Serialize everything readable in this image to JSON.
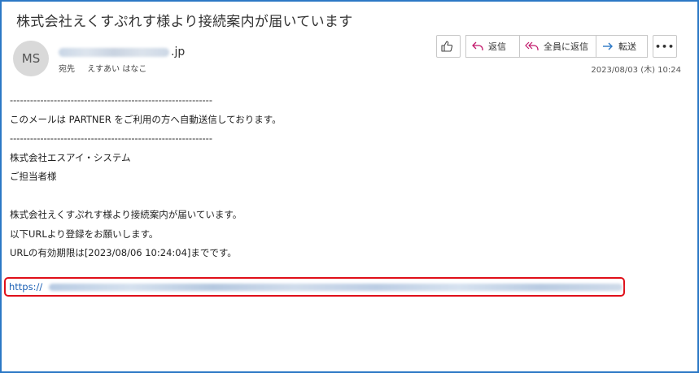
{
  "email": {
    "subject": "株式会社えくすぷれす様より接続案内が届いています",
    "avatar_initials": "MS",
    "sender_domain": ".jp",
    "to_label": "宛先",
    "to_name": "えすあい はなこ",
    "date": "2023/08/03 (木) 10:24"
  },
  "toolbar": {
    "like_icon": "thumbs-up-icon",
    "reply_label": "返信",
    "reply_all_label": "全員に返信",
    "forward_label": "転送",
    "more_label": "•••"
  },
  "body": {
    "lines": [
      "------------------------------------------------------------",
      "このメールは PARTNER をご利用の方へ自動送信しております。",
      "------------------------------------------------------------",
      "株式会社エスアイ・システム",
      "ご担当者様",
      "",
      "株式会社えくすぷれす様より接続案内が届いています。",
      "以下URLより登録をお願いします。",
      "URLの有効期限は[2023/08/06 10:24:04]までです。"
    ],
    "link_prefix": "https://"
  },
  "colors": {
    "frame_border": "#2b78c5",
    "highlight_border": "#e0101a",
    "link": "#1a5fb4",
    "reply_icon": "#c2186b",
    "forward_icon": "#2b78c5"
  }
}
